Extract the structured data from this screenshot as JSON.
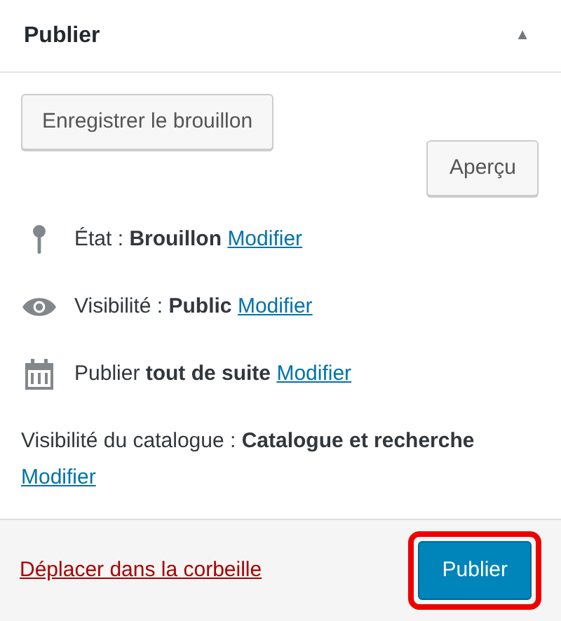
{
  "panel": {
    "title": "Publier",
    "collapse_icon": "▲"
  },
  "buttons": {
    "save_draft": "Enregistrer le brouillon",
    "preview": "Aperçu"
  },
  "rows": [
    {
      "kind": "status",
      "text": "État : **Brouillon**",
      "link": "Modifier"
    },
    {
      "kind": "visibility",
      "text": "Visibilité : **Public**",
      "link": "Modifier"
    },
    {
      "kind": "schedule",
      "text": "Publier **tout de suite**",
      "link": "Modifier"
    },
    {
      "kind": "plain",
      "text": "Visibilité du catalogue : **Catalogue et recherche**",
      "link": "Modifier"
    }
  ],
  "footer": {
    "trash_link": "Déplacer dans la corbeille",
    "publish_button": "Publier",
    "publish_highlighted": true
  }
}
